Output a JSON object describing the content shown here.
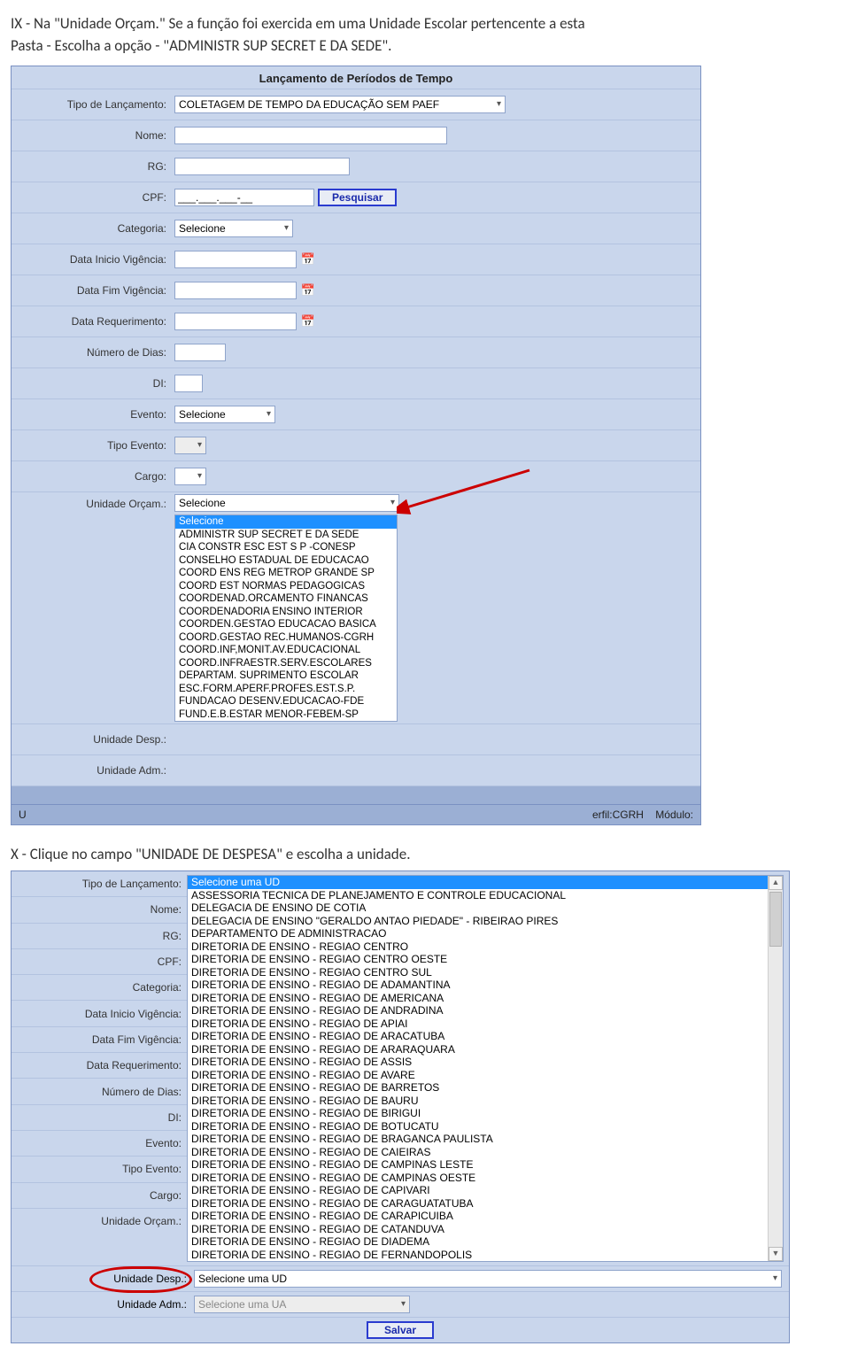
{
  "instructions": {
    "line1": "IX -  Na \"Unidade Orçam.\" Se a função foi exercida em uma Unidade Escolar pertencente a esta",
    "line2": "Pasta - Escolha a opção - \"ADMINISTR SUP SECRET E DA SEDE\".",
    "second": "X - Clique no campo \"UNIDADE DE DESPESA\" e escolha a unidade."
  },
  "panel1": {
    "title": "Lançamento de Períodos de Tempo",
    "labels": {
      "tipoLanc": "Tipo de Lançamento:",
      "nome": "Nome:",
      "rg": "RG:",
      "cpf": "CPF:",
      "categoria": "Categoria:",
      "dataIni": "Data Inicio Vigência:",
      "dataFim": "Data Fim Vigência:",
      "dataReq": "Data Requerimento:",
      "numDias": "Número de Dias:",
      "di": "DI:",
      "evento": "Evento:",
      "tipoEvento": "Tipo Evento:",
      "cargo": "Cargo:",
      "unidOrcam": "Unidade Orçam.:",
      "unidDesp": "Unidade Desp.:",
      "unidAdm": "Unidade Adm.:"
    },
    "values": {
      "tipoLancamento": "COLETAGEM DE TEMPO DA EDUCAÇÃO SEM PAEF",
      "cpfMask": "___.___.___-__",
      "pesquisar": "Pesquisar",
      "categoria": "Selecione",
      "evento": "Selecione",
      "unidOrcamSelected": "Selecione"
    },
    "orcamOptions": [
      "Selecione",
      "ADMINISTR SUP SECRET E DA SEDE",
      "CIA CONSTR ESC EST S P -CONESP",
      "CONSELHO ESTADUAL DE EDUCACAO",
      "COORD ENS REG METROP GRANDE SP",
      "COORD EST NORMAS PEDAGOGICAS",
      "COORDENAD.ORCAMENTO FINANCAS",
      "COORDENADORIA ENSINO INTERIOR",
      "COORDEN.GESTAO EDUCACAO BASICA",
      "COORD.GESTAO REC.HUMANOS-CGRH",
      "COORD.INF,MONIT.AV.EDUCACIONAL",
      "COORD.INFRAESTR.SERV.ESCOLARES",
      "DEPARTAM. SUPRIMENTO ESCOLAR",
      "ESC.FORM.APERF.PROFES.EST.S.P.",
      "FUNDACAO DESENV.EDUCACAO-FDE",
      "FUND.E.B.ESTAR MENOR-FEBEM-SP"
    ],
    "footer": {
      "u": "U",
      "perfil": "erfil:CGRH",
      "modulo": "Módulo:"
    }
  },
  "panel2": {
    "labels": [
      "Tipo de Lançamento:",
      "Nome:",
      "RG:",
      "CPF:",
      "Categoria:",
      "Data Inicio Vigência:",
      "Data Fim Vigência:",
      "Data Requerimento:",
      "Número de Dias:",
      "DI:",
      "Evento:",
      "Tipo Evento:",
      "Cargo:",
      "Unidade Orçam.:"
    ],
    "udOptions": [
      "Selecione uma UD",
      "ASSESSORIA TECNICA DE PLANEJAMENTO E CONTROLE EDUCACIONAL",
      "DELEGACIA DE ENSINO DE COTIA",
      "DELEGACIA DE ENSINO \"GERALDO ANTAO PIEDADE\" - RIBEIRAO PIRES",
      "DEPARTAMENTO DE ADMINISTRACAO",
      "DIRETORIA DE ENSINO - REGIAO CENTRO",
      "DIRETORIA DE ENSINO - REGIAO CENTRO OESTE",
      "DIRETORIA DE ENSINO - REGIAO CENTRO SUL",
      "DIRETORIA DE ENSINO - REGIAO DE ADAMANTINA",
      "DIRETORIA DE ENSINO - REGIAO DE AMERICANA",
      "DIRETORIA DE ENSINO - REGIAO DE ANDRADINA",
      "DIRETORIA DE ENSINO - REGIAO DE APIAI",
      "DIRETORIA DE ENSINO - REGIAO DE ARACATUBA",
      "DIRETORIA DE ENSINO - REGIAO DE ARARAQUARA",
      "DIRETORIA DE ENSINO - REGIAO DE ASSIS",
      "DIRETORIA DE ENSINO - REGIAO DE AVARE",
      "DIRETORIA DE ENSINO - REGIAO DE BARRETOS",
      "DIRETORIA DE ENSINO - REGIAO DE BAURU",
      "DIRETORIA DE ENSINO - REGIAO DE BIRIGUI",
      "DIRETORIA DE ENSINO - REGIAO DE BOTUCATU",
      "DIRETORIA DE ENSINO - REGIAO DE BRAGANCA PAULISTA",
      "DIRETORIA DE ENSINO - REGIAO DE CAIEIRAS",
      "DIRETORIA DE ENSINO - REGIAO DE CAMPINAS LESTE",
      "DIRETORIA DE ENSINO - REGIAO DE CAMPINAS OESTE",
      "DIRETORIA DE ENSINO - REGIAO DE CAPIVARI",
      "DIRETORIA DE ENSINO - REGIAO DE CARAGUATATUBA",
      "DIRETORIA DE ENSINO - REGIAO DE CARAPICUIBA",
      "DIRETORIA DE ENSINO - REGIAO DE CATANDUVA",
      "DIRETORIA DE ENSINO - REGIAO DE DIADEMA",
      "DIRETORIA DE ENSINO - REGIAO DE FERNANDOPOLIS"
    ],
    "despLabel": "Unidade Desp.:",
    "despValue": "Selecione uma UD",
    "admLabel": "Unidade Adm.:",
    "admValue": "Selecione uma UA",
    "salvar": "Salvar"
  }
}
